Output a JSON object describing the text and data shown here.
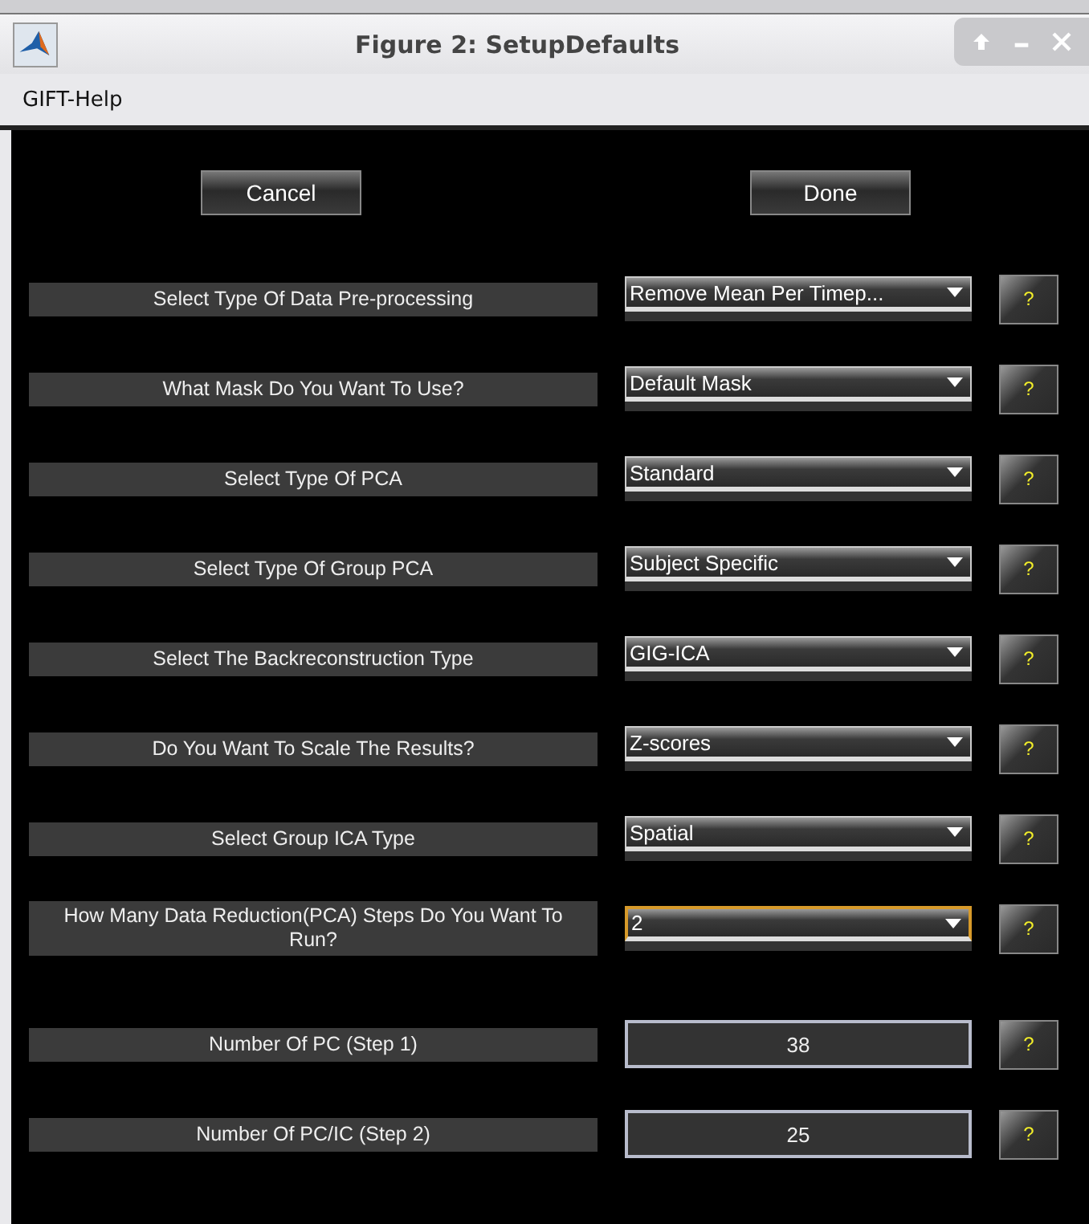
{
  "window": {
    "title": "Figure 2: SetupDefaults"
  },
  "menu": [
    "GIFT-Help"
  ],
  "buttons": [
    "Cancel",
    "Done"
  ],
  "settings": [
    {
      "label": "Select Type Of Data Pre-processing",
      "kind": "dropdown",
      "value": "Remove Mean Per Timep...",
      "focused": false,
      "help": "?"
    },
    {
      "label": "What Mask Do You Want To Use?",
      "kind": "dropdown",
      "value": "Default Mask",
      "focused": false,
      "help": "?"
    },
    {
      "label": "Select Type Of PCA",
      "kind": "dropdown",
      "value": "Standard",
      "focused": false,
      "help": "?"
    },
    {
      "label": "Select Type Of Group PCA",
      "kind": "dropdown",
      "value": "Subject Specific",
      "focused": false,
      "help": "?"
    },
    {
      "label": "Select The Backreconstruction Type",
      "kind": "dropdown",
      "value": "GIG-ICA",
      "focused": false,
      "help": "?"
    },
    {
      "label": "Do You Want To Scale The Results?",
      "kind": "dropdown",
      "value": "Z-scores",
      "focused": false,
      "help": "?"
    },
    {
      "label": "Select Group ICA Type",
      "kind": "dropdown",
      "value": "Spatial",
      "focused": false,
      "help": "?"
    },
    {
      "label": "How Many Data Reduction(PCA) Steps Do You Want To Run?",
      "kind": "dropdown",
      "value": "2",
      "focused": true,
      "help": "?"
    },
    {
      "label": "Number Of PC (Step 1)",
      "kind": "field",
      "value": "38",
      "focused": false,
      "help": "?"
    },
    {
      "label": "Number Of PC/IC (Step 2)",
      "kind": "field",
      "value": "25",
      "focused": false,
      "help": "?"
    }
  ]
}
